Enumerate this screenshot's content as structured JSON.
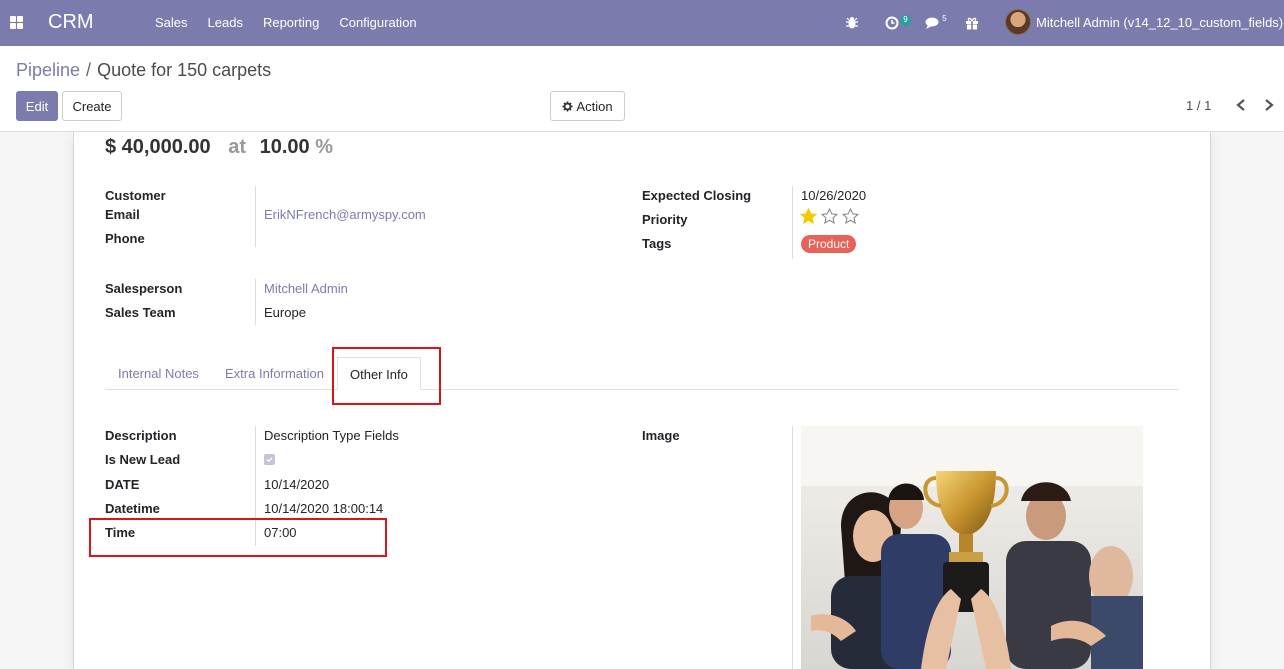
{
  "navbar": {
    "app_name": "CRM",
    "menu": [
      "Sales",
      "Leads",
      "Reporting",
      "Configuration"
    ],
    "activity_badge": "9",
    "messages_badge": "5",
    "user_name": "Mitchell Admin (v14_12_10_custom_fields)"
  },
  "breadcrumb": {
    "parent": "Pipeline",
    "separator": "/",
    "current": "Quote for 150 carpets"
  },
  "buttons": {
    "edit": "Edit",
    "create": "Create",
    "action": "Action"
  },
  "pager": {
    "value": "1 / 1"
  },
  "form": {
    "amount": "$ 40,000.00",
    "at": "at",
    "probability": "10.00",
    "percent": "%",
    "customer_label": "Customer",
    "email_label": "Email",
    "email_value": "ErikNFrench@armyspy.com",
    "phone_label": "Phone",
    "expected_closing_label": "Expected Closing",
    "expected_closing_value": "10/26/2020",
    "priority_label": "Priority",
    "priority_value": 1,
    "priority_max": 3,
    "tags_label": "Tags",
    "tag_value": "Product",
    "salesperson_label": "Salesperson",
    "salesperson_value": "Mitchell Admin",
    "sales_team_label": "Sales Team",
    "sales_team_value": "Europe"
  },
  "tabs": {
    "internal_notes": "Internal Notes",
    "extra_information": "Extra Information",
    "other_info": "Other Info"
  },
  "other_info": {
    "description_label": "Description",
    "description_value": "Description Type Fields",
    "is_new_lead_label": "Is New Lead",
    "is_new_lead_value": true,
    "date_label": "DATE",
    "date_value": "10/14/2020",
    "datetime_label": "Datetime",
    "datetime_value": "10/14/2020 18:00:14",
    "time_label": "Time",
    "time_value": "07:00",
    "image_label": "Image"
  },
  "colors": {
    "brand": "#7c7bad",
    "tag": "#e8625a",
    "highlight": "#d7151d",
    "star": "#f3cc00"
  }
}
